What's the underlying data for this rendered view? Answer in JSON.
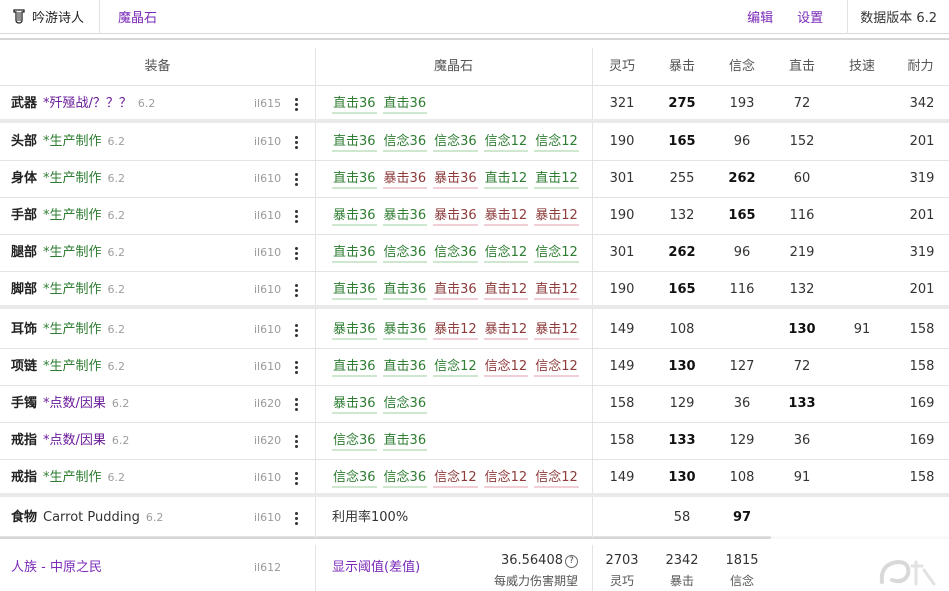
{
  "header": {
    "job_name": "吟游诗人",
    "tab_meld": "魔晶石",
    "edit_label": "编辑",
    "settings_label": "设置",
    "data_version": "数据版本 6.2"
  },
  "columns": {
    "equipment": "装备",
    "materia": "魔晶石",
    "stats": [
      "灵巧",
      "暴击",
      "信念",
      "直击",
      "技速",
      "耐力"
    ]
  },
  "rows": [
    {
      "slot": "武器",
      "name": "*歼殛战/？？？",
      "version": "6.2",
      "ilvl": "il615",
      "name_color": "purple",
      "materias": [
        {
          "text": "直击36",
          "kind": "g"
        },
        {
          "text": "直击36",
          "kind": "g"
        }
      ],
      "stats": [
        "321",
        "275",
        "193",
        "72",
        "",
        "342"
      ],
      "bold": [
        1
      ]
    },
    {
      "slot": "头部",
      "name": "*生产制作",
      "version": "6.2",
      "ilvl": "il610",
      "name_color": "green",
      "materias": [
        {
          "text": "直击36",
          "kind": "g"
        },
        {
          "text": "信念36",
          "kind": "g"
        },
        {
          "text": "信念36",
          "kind": "g"
        },
        {
          "text": "信念12",
          "kind": "g"
        },
        {
          "text": "信念12",
          "kind": "g"
        }
      ],
      "stats": [
        "190",
        "165",
        "96",
        "152",
        "",
        "201"
      ],
      "bold": [
        1
      ]
    },
    {
      "slot": "身体",
      "name": "*生产制作",
      "version": "6.2",
      "ilvl": "il610",
      "name_color": "green",
      "materias": [
        {
          "text": "直击36",
          "kind": "g"
        },
        {
          "text": "暴击36",
          "kind": "pk"
        },
        {
          "text": "暴击36",
          "kind": "pk"
        },
        {
          "text": "直击12",
          "kind": "g"
        },
        {
          "text": "直击12",
          "kind": "g"
        }
      ],
      "stats": [
        "301",
        "255",
        "262",
        "60",
        "",
        "319"
      ],
      "bold": [
        2
      ]
    },
    {
      "slot": "手部",
      "name": "*生产制作",
      "version": "6.2",
      "ilvl": "il610",
      "name_color": "green",
      "materias": [
        {
          "text": "暴击36",
          "kind": "g"
        },
        {
          "text": "暴击36",
          "kind": "g"
        },
        {
          "text": "暴击36",
          "kind": "pk"
        },
        {
          "text": "暴击12",
          "kind": "pk"
        },
        {
          "text": "暴击12",
          "kind": "pk"
        }
      ],
      "stats": [
        "190",
        "132",
        "165",
        "116",
        "",
        "201"
      ],
      "bold": [
        2
      ]
    },
    {
      "slot": "腿部",
      "name": "*生产制作",
      "version": "6.2",
      "ilvl": "il610",
      "name_color": "green",
      "materias": [
        {
          "text": "直击36",
          "kind": "g"
        },
        {
          "text": "信念36",
          "kind": "g"
        },
        {
          "text": "信念36",
          "kind": "g"
        },
        {
          "text": "信念12",
          "kind": "g"
        },
        {
          "text": "信念12",
          "kind": "g"
        }
      ],
      "stats": [
        "301",
        "262",
        "96",
        "219",
        "",
        "319"
      ],
      "bold": [
        1
      ]
    },
    {
      "slot": "脚部",
      "name": "*生产制作",
      "version": "6.2",
      "ilvl": "il610",
      "name_color": "green",
      "materias": [
        {
          "text": "直击36",
          "kind": "g"
        },
        {
          "text": "直击36",
          "kind": "g"
        },
        {
          "text": "直击36",
          "kind": "pk"
        },
        {
          "text": "直击12",
          "kind": "pk"
        },
        {
          "text": "直击12",
          "kind": "pk"
        }
      ],
      "stats": [
        "190",
        "165",
        "116",
        "132",
        "",
        "201"
      ],
      "bold": [
        1
      ]
    },
    {
      "slot": "耳饰",
      "name": "*生产制作",
      "version": "6.2",
      "ilvl": "il610",
      "name_color": "green",
      "materias": [
        {
          "text": "暴击36",
          "kind": "g"
        },
        {
          "text": "暴击36",
          "kind": "g"
        },
        {
          "text": "暴击12",
          "kind": "pk"
        },
        {
          "text": "暴击12",
          "kind": "pk"
        },
        {
          "text": "暴击12",
          "kind": "pk"
        }
      ],
      "stats": [
        "149",
        "108",
        "",
        "130",
        "91",
        "158"
      ],
      "bold": [
        3
      ]
    },
    {
      "slot": "项链",
      "name": "*生产制作",
      "version": "6.2",
      "ilvl": "il610",
      "name_color": "green",
      "materias": [
        {
          "text": "直击36",
          "kind": "g"
        },
        {
          "text": "直击36",
          "kind": "g"
        },
        {
          "text": "信念12",
          "kind": "g"
        },
        {
          "text": "信念12",
          "kind": "pk"
        },
        {
          "text": "信念12",
          "kind": "pk"
        }
      ],
      "stats": [
        "149",
        "130",
        "127",
        "72",
        "",
        "158"
      ],
      "bold": [
        1
      ]
    },
    {
      "slot": "手镯",
      "name": "*点数/因果",
      "version": "6.2",
      "ilvl": "il620",
      "name_color": "purple",
      "materias": [
        {
          "text": "暴击36",
          "kind": "g"
        },
        {
          "text": "信念36",
          "kind": "g"
        }
      ],
      "stats": [
        "158",
        "129",
        "36",
        "133",
        "",
        "169"
      ],
      "bold": [
        3
      ]
    },
    {
      "slot": "戒指",
      "name": "*点数/因果",
      "version": "6.2",
      "ilvl": "il620",
      "name_color": "purple",
      "materias": [
        {
          "text": "信念36",
          "kind": "g"
        },
        {
          "text": "直击36",
          "kind": "g"
        }
      ],
      "stats": [
        "158",
        "133",
        "129",
        "36",
        "",
        "169"
      ],
      "bold": [
        1
      ]
    },
    {
      "slot": "戒指",
      "name": "*生产制作",
      "version": "6.2",
      "ilvl": "il610",
      "name_color": "green",
      "materias": [
        {
          "text": "信念36",
          "kind": "g"
        },
        {
          "text": "信念36",
          "kind": "g"
        },
        {
          "text": "信念12",
          "kind": "pk"
        },
        {
          "text": "信念12",
          "kind": "pk"
        },
        {
          "text": "信念12",
          "kind": "pk"
        }
      ],
      "stats": [
        "149",
        "130",
        "108",
        "91",
        "",
        "158"
      ],
      "bold": [
        1
      ]
    },
    {
      "slot": "食物",
      "name": "Carrot Pudding",
      "version": "6.2",
      "ilvl": "il610",
      "name_color": "plain",
      "usage": "利用率100%",
      "stats": [
        "",
        "58",
        "97",
        "",
        "",
        ""
      ],
      "bold": [
        2
      ]
    }
  ],
  "footer": {
    "race": "人族 - 中原之民",
    "ilvl": "il612",
    "threshold_label": "显示阈值(差值)",
    "damage_value": "36.56408",
    "damage_help": "?",
    "damage_label": "每威力伤害期望",
    "totals": [
      {
        "value": "2703",
        "label": "灵巧"
      },
      {
        "value": "2342",
        "label": "暴击"
      },
      {
        "value": "1815",
        "label": "信念"
      }
    ]
  },
  "watermark": "九游",
  "colors": {
    "accent_purple": "#7a2ab8",
    "item_green": "#2e7d32",
    "item_purple": "#6a1b9a",
    "materia_pink": "#8d3b3b"
  }
}
